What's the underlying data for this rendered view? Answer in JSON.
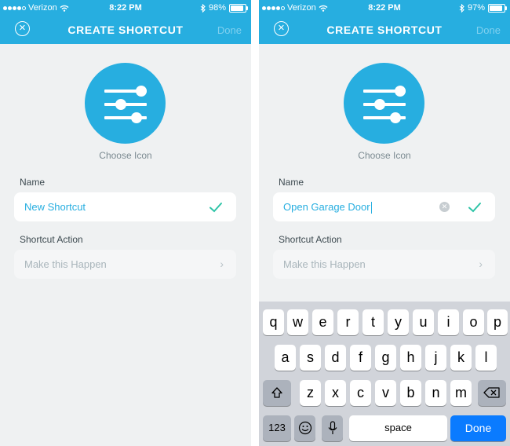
{
  "left_screen": {
    "status_bar": {
      "carrier": "Verizon",
      "time": "8:22 PM",
      "battery": "98%"
    },
    "header": {
      "title": "CREATE SHORTCUT",
      "done_label": "Done"
    },
    "choose_icon_label": "Choose Icon",
    "name_label": "Name",
    "name_value": "New Shortcut",
    "action_label": "Shortcut Action",
    "action_placeholder": "Make this Happen"
  },
  "right_screen": {
    "status_bar": {
      "carrier": "Verizon",
      "time": "8:22 PM",
      "battery": "97%"
    },
    "header": {
      "title": "CREATE SHORTCUT",
      "done_label": "Done"
    },
    "choose_icon_label": "Choose Icon",
    "name_label": "Name",
    "name_value": "Open Garage Door",
    "action_label": "Shortcut Action",
    "action_placeholder": "Make this Happen",
    "keyboard": {
      "row1": [
        "q",
        "w",
        "e",
        "r",
        "t",
        "y",
        "u",
        "i",
        "o",
        "p"
      ],
      "row2": [
        "a",
        "s",
        "d",
        "f",
        "g",
        "h",
        "j",
        "k",
        "l"
      ],
      "row3": [
        "z",
        "x",
        "c",
        "v",
        "b",
        "n",
        "m"
      ],
      "numbers_key": "123",
      "space_key": "space",
      "done_key": "Done"
    }
  },
  "colors": {
    "accent": "#27aee0",
    "check": "#2ec4a7",
    "keyboard_done": "#0a7bff"
  },
  "icons": [
    "close-icon",
    "sliders-icon",
    "check-icon",
    "chevron-right-icon",
    "clear-icon",
    "shift-icon",
    "backspace-icon",
    "emoji-icon",
    "microphone-icon",
    "wifi-icon",
    "bluetooth-icon",
    "battery-icon"
  ]
}
